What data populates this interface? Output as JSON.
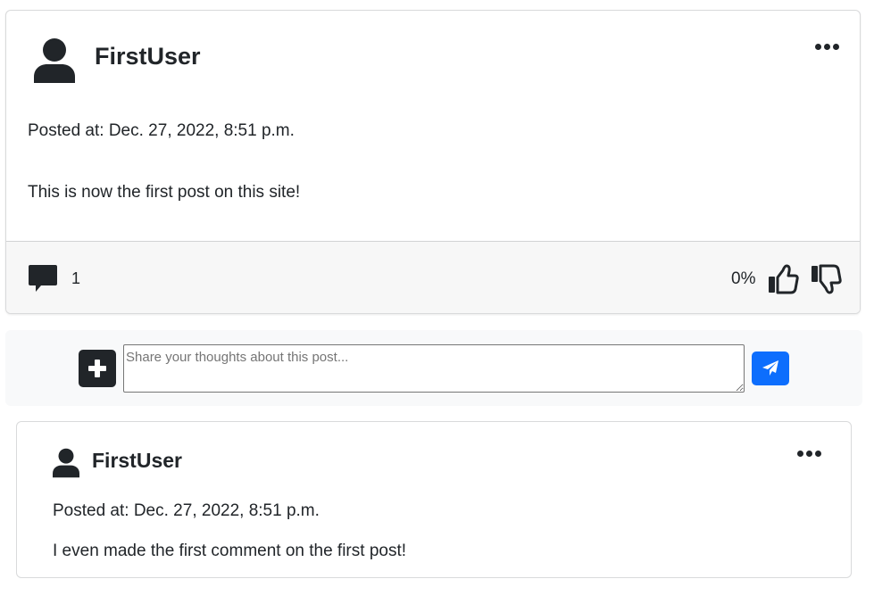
{
  "post": {
    "username": "FirstUser",
    "posted_at": "Posted at: Dec. 27, 2022, 8:51 p.m.",
    "body": "This is now the first post on this site!",
    "comment_count": "1",
    "vote_percentage": "0%",
    "icons": {
      "avatar": "person-icon",
      "menu": "ellipsis-icon",
      "comments": "comment-icon",
      "like": "thumbs-up-icon",
      "dislike": "thumbs-down-icon"
    }
  },
  "comment_form": {
    "placeholder": "Share your thoughts about this post...",
    "value": "",
    "icons": {
      "add": "plus-icon",
      "send": "paper-plane-icon"
    },
    "colors": {
      "add_button": "#212529",
      "send_button": "#0d6efd"
    }
  },
  "comments": [
    {
      "username": "FirstUser",
      "posted_at": "Posted at: Dec. 27, 2022, 8:51 p.m.",
      "body": "I even made the first comment on the first post!"
    }
  ]
}
